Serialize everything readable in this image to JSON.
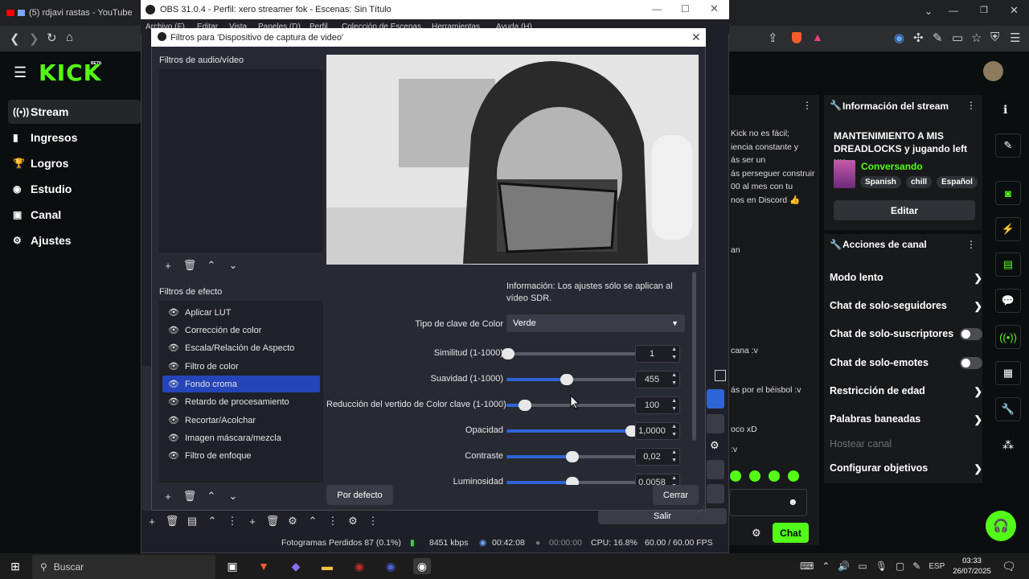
{
  "browser": {
    "tab_title": "(5) rdjavi rastas - YouTube",
    "url": ""
  },
  "kick": {
    "logo": "KICK",
    "beta": "BETA",
    "nav": [
      {
        "label": "Stream",
        "icon": "broadcast-icon"
      },
      {
        "label": "Ingresos",
        "icon": "chart-icon"
      },
      {
        "label": "Logros",
        "icon": "trophy-icon"
      },
      {
        "label": "Estudio",
        "icon": "video-icon"
      },
      {
        "label": "Canal",
        "icon": "user-icon"
      },
      {
        "label": "Ajustes",
        "icon": "gear-icon"
      }
    ],
    "chat_snippets": [
      "Kick no es fácil;",
      "iencia constante y",
      "ás ser un",
      "ás perseguer construir una",
      "00 al mes con tu",
      "nos en Discord 👍",
      "an",
      "cana :v",
      "ás por el béisbol :v",
      "oco xD",
      ":v"
    ],
    "stream_info": {
      "header": "Información del stream",
      "title": "MANTENIMIENTO A MIS DREADLOCKS y jugando left uu",
      "category": "Conversando",
      "tags": [
        "Spanish",
        "chill",
        "Español"
      ],
      "edit_button": "Editar"
    },
    "channel_actions": {
      "header": "Acciones de canal",
      "items": [
        {
          "label": "Modo lento",
          "control": "chevron"
        },
        {
          "label": "Chat de solo-seguidores",
          "control": "chevron"
        },
        {
          "label": "Chat de solo-suscriptores",
          "control": "toggle"
        },
        {
          "label": "Chat de solo-emotes",
          "control": "toggle"
        },
        {
          "label": "Restricción de edad",
          "control": "chevron"
        },
        {
          "label": "Palabras baneadas",
          "control": "chevron"
        },
        {
          "label": "Hostear canal",
          "control": "none"
        },
        {
          "label": "Configurar objetivos",
          "control": "chevron"
        }
      ]
    },
    "chat_button": "Chat",
    "accent_color": "#53fc18"
  },
  "obs": {
    "window_title": "OBS 31.0.4 - Perfil: xero streamer fok - Escenas: Sin Título",
    "menu": [
      "Archivo (F)",
      "Editar",
      "Vista",
      "Paneles (D)",
      "Perfil",
      "Colección de Escenas",
      "Herramientas",
      "Ayuda (H)"
    ],
    "exit_button": "Salir",
    "status": {
      "dropped_frames": "Fotogramas Perdidos 87 (0.1%)",
      "bitrate": "8451 kbps",
      "stream_time": "00:42:08",
      "rec_time": "00:00:00",
      "cpu": "CPU: 16.8%",
      "fps": "60.00 / 60.00 FPS"
    }
  },
  "filters_dialog": {
    "title": "Filtros para 'Dispositivo de captura de video'",
    "audio_video_header": "Filtros de audio/vídeo",
    "effect_header": "Filtros de efecto",
    "effects": [
      "Aplicar LUT",
      "Corrección de color",
      "Escala/Relación de Aspecto",
      "Filtro de color",
      "Fondo croma",
      "Retardo de procesamiento",
      "Recortar/Acolchar",
      "Imagen máscara/mezcla",
      "Filtro de enfoque"
    ],
    "selected_effect": "Fondo croma",
    "info_text": "Información: Los ajustes sólo se aplican al vídeo SDR.",
    "key_type_label": "Tipo de clave de Color",
    "key_type_value": "Verde",
    "sliders": [
      {
        "label": "Similitud (1-1000)",
        "value": "1",
        "fraction": 0.01
      },
      {
        "label": "Suavidad (1-1000)",
        "value": "455",
        "fraction": 0.46
      },
      {
        "label": "Reducción del vertido de Color clave (1-1000)",
        "value": "100",
        "fraction": 0.14
      },
      {
        "label": "Opacidad",
        "value": "1,0000",
        "fraction": 0.95
      },
      {
        "label": "Contraste",
        "value": "0,02",
        "fraction": 0.5
      },
      {
        "label": "Luminosidad",
        "value": "0,0058",
        "fraction": 0.5
      }
    ],
    "defaults_button": "Por defecto",
    "close_button": "Cerrar"
  },
  "taskbar": {
    "search_placeholder": "Buscar",
    "lang": "ESP",
    "time": "03:33",
    "date": "26/07/2025"
  }
}
